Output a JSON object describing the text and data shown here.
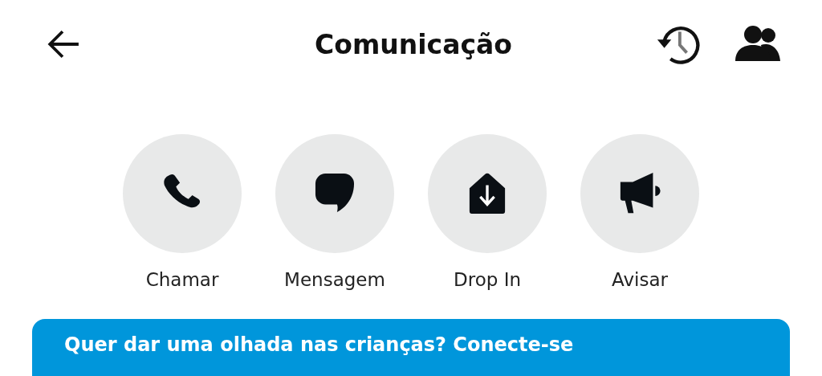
{
  "header": {
    "title": "Comunicação"
  },
  "actions": [
    {
      "kind": "call",
      "label": "Chamar"
    },
    {
      "kind": "message",
      "label": "Mensagem"
    },
    {
      "kind": "drop-in",
      "label": "Drop In"
    },
    {
      "kind": "announce",
      "label": "Avisar"
    }
  ],
  "banner": {
    "text": "Quer dar uma olhada nas crianças? Conecte-se"
  }
}
